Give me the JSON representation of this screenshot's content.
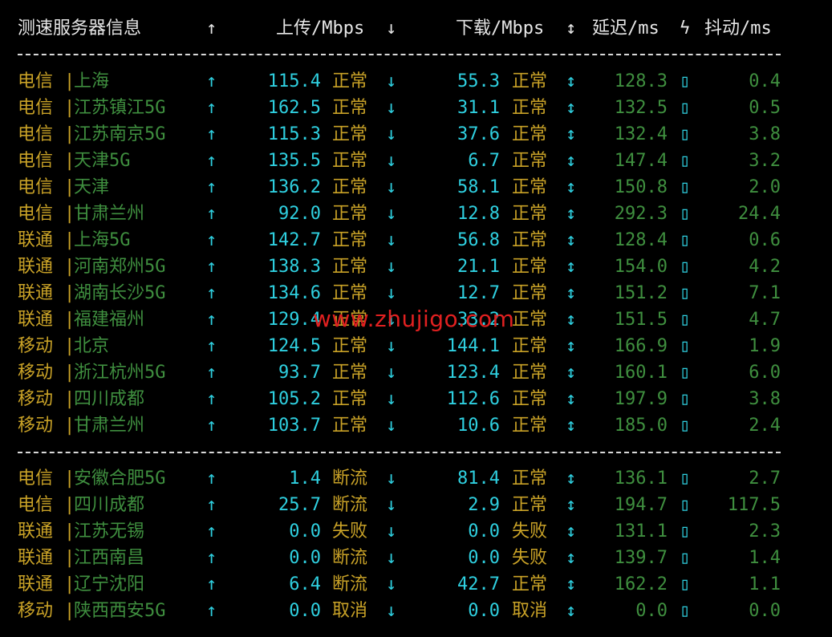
{
  "header": {
    "server_info": "测速服务器信息",
    "up_arrow": "↑",
    "upload": "上传/Mbps",
    "down_arrow": "↓",
    "download": "下载/Mbps",
    "updown_arrow": "↕",
    "latency": "延迟/ms",
    "bolt": "ϟ",
    "jitter": "抖动/ms"
  },
  "icons": {
    "up": "↑",
    "down": "↓",
    "updown": "↕",
    "box": "▯",
    "pipe": "|"
  },
  "group1": [
    {
      "isp": "电信",
      "loc": "上海",
      "up": "115.4",
      "up_status": "正常",
      "down": "55.3",
      "down_status": "正常",
      "latency": "128.3",
      "jitter": "0.4"
    },
    {
      "isp": "电信",
      "loc": "江苏镇江5G",
      "up": "162.5",
      "up_status": "正常",
      "down": "31.1",
      "down_status": "正常",
      "latency": "132.5",
      "jitter": "0.5"
    },
    {
      "isp": "电信",
      "loc": "江苏南京5G",
      "up": "115.3",
      "up_status": "正常",
      "down": "37.6",
      "down_status": "正常",
      "latency": "132.4",
      "jitter": "3.8"
    },
    {
      "isp": "电信",
      "loc": "天津5G",
      "up": "135.5",
      "up_status": "正常",
      "down": "6.7",
      "down_status": "正常",
      "latency": "147.4",
      "jitter": "3.2"
    },
    {
      "isp": "电信",
      "loc": "天津",
      "up": "136.2",
      "up_status": "正常",
      "down": "58.1",
      "down_status": "正常",
      "latency": "150.8",
      "jitter": "2.0"
    },
    {
      "isp": "电信",
      "loc": "甘肃兰州",
      "up": "92.0",
      "up_status": "正常",
      "down": "12.8",
      "down_status": "正常",
      "latency": "292.3",
      "jitter": "24.4"
    },
    {
      "isp": "联通",
      "loc": "上海5G",
      "up": "142.7",
      "up_status": "正常",
      "down": "56.8",
      "down_status": "正常",
      "latency": "128.4",
      "jitter": "0.6"
    },
    {
      "isp": "联通",
      "loc": "河南郑州5G",
      "up": "138.3",
      "up_status": "正常",
      "down": "21.1",
      "down_status": "正常",
      "latency": "154.0",
      "jitter": "4.2"
    },
    {
      "isp": "联通",
      "loc": "湖南长沙5G",
      "up": "134.6",
      "up_status": "正常",
      "down": "12.7",
      "down_status": "正常",
      "latency": "151.2",
      "jitter": "7.1"
    },
    {
      "isp": "联通",
      "loc": "福建福州",
      "up": "129.4",
      "up_status": "正常",
      "down": "33.2",
      "down_status": "正常",
      "latency": "151.5",
      "jitter": "4.7"
    },
    {
      "isp": "移动",
      "loc": "北京",
      "up": "124.5",
      "up_status": "正常",
      "down": "144.1",
      "down_status": "正常",
      "latency": "166.9",
      "jitter": "1.9"
    },
    {
      "isp": "移动",
      "loc": "浙江杭州5G",
      "up": "93.7",
      "up_status": "正常",
      "down": "123.4",
      "down_status": "正常",
      "latency": "160.1",
      "jitter": "6.0"
    },
    {
      "isp": "移动",
      "loc": "四川成都",
      "up": "105.2",
      "up_status": "正常",
      "down": "112.6",
      "down_status": "正常",
      "latency": "197.9",
      "jitter": "3.8"
    },
    {
      "isp": "移动",
      "loc": "甘肃兰州",
      "up": "103.7",
      "up_status": "正常",
      "down": "10.6",
      "down_status": "正常",
      "latency": "185.0",
      "jitter": "2.4"
    }
  ],
  "group2": [
    {
      "isp": "电信",
      "loc": "安徽合肥5G",
      "up": "1.4",
      "up_status": "断流",
      "down": "81.4",
      "down_status": "正常",
      "latency": "136.1",
      "jitter": "2.7"
    },
    {
      "isp": "电信",
      "loc": "四川成都",
      "up": "25.7",
      "up_status": "断流",
      "down": "2.9",
      "down_status": "正常",
      "latency": "194.7",
      "jitter": "117.5"
    },
    {
      "isp": "联通",
      "loc": "江苏无锡",
      "up": "0.0",
      "up_status": "失败",
      "down": "0.0",
      "down_status": "失败",
      "latency": "131.1",
      "jitter": "2.3"
    },
    {
      "isp": "联通",
      "loc": "江西南昌",
      "up": "0.0",
      "up_status": "断流",
      "down": "0.0",
      "down_status": "失败",
      "latency": "139.7",
      "jitter": "1.4"
    },
    {
      "isp": "联通",
      "loc": "辽宁沈阳",
      "up": "6.4",
      "up_status": "断流",
      "down": "42.7",
      "down_status": "正常",
      "latency": "162.2",
      "jitter": "1.1"
    },
    {
      "isp": "移动",
      "loc": "陕西西安5G",
      "up": "0.0",
      "up_status": "取消",
      "down": "0.0",
      "down_status": "取消",
      "latency": "0.0",
      "jitter": "0.0"
    }
  ],
  "watermark": "www.zhujigo.com"
}
